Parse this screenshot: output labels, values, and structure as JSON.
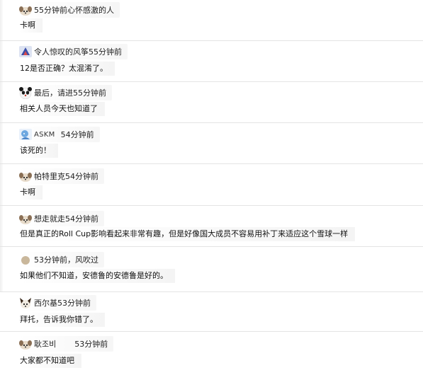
{
  "comments": [
    {
      "author": "55分钟前心怀感激的人",
      "time": "",
      "text": "卡啊",
      "avatar_icon": "dog-avatar-icon"
    },
    {
      "author": "令人惊叹的风筝55分钟前",
      "time": "",
      "text": "12是否正确？太混淆了。",
      "avatar_icon": "kite-avatar-icon"
    },
    {
      "author": "最后，请进55分钟前",
      "time": "",
      "text": "相关人员今天也知道了",
      "avatar_icon": "panda-avatar-icon"
    },
    {
      "author": "ASKM",
      "time": "54分钟前",
      "text": "该死的！",
      "avatar_icon": "character-avatar-icon"
    },
    {
      "author": "帕特里克54分钟前",
      "time": "",
      "text": "卡啊",
      "avatar_icon": "dog-avatar-icon"
    },
    {
      "author": "想走就走54分钟前",
      "time": "",
      "text": "但是真正的Roll Cup影响看起来非常有趣，但是好像国大成员不容易用补丁来适应这个雪球一样",
      "avatar_icon": "dog-avatar-icon"
    },
    {
      "author": "53分钟前，风吹过",
      "time": "",
      "text": "如果他们不知道，安德鲁的安德鲁是好的。",
      "avatar_icon": "circle-avatar-icon"
    },
    {
      "author": "西尔基53分钟前",
      "time": "",
      "text": "拜托，告诉我你错了。",
      "avatar_icon": "dog-avatar-icon"
    },
    {
      "author": "耿조비",
      "time": "53分钟前",
      "text": "大家都不知道吧",
      "avatar_icon": "dog-avatar-icon"
    }
  ]
}
